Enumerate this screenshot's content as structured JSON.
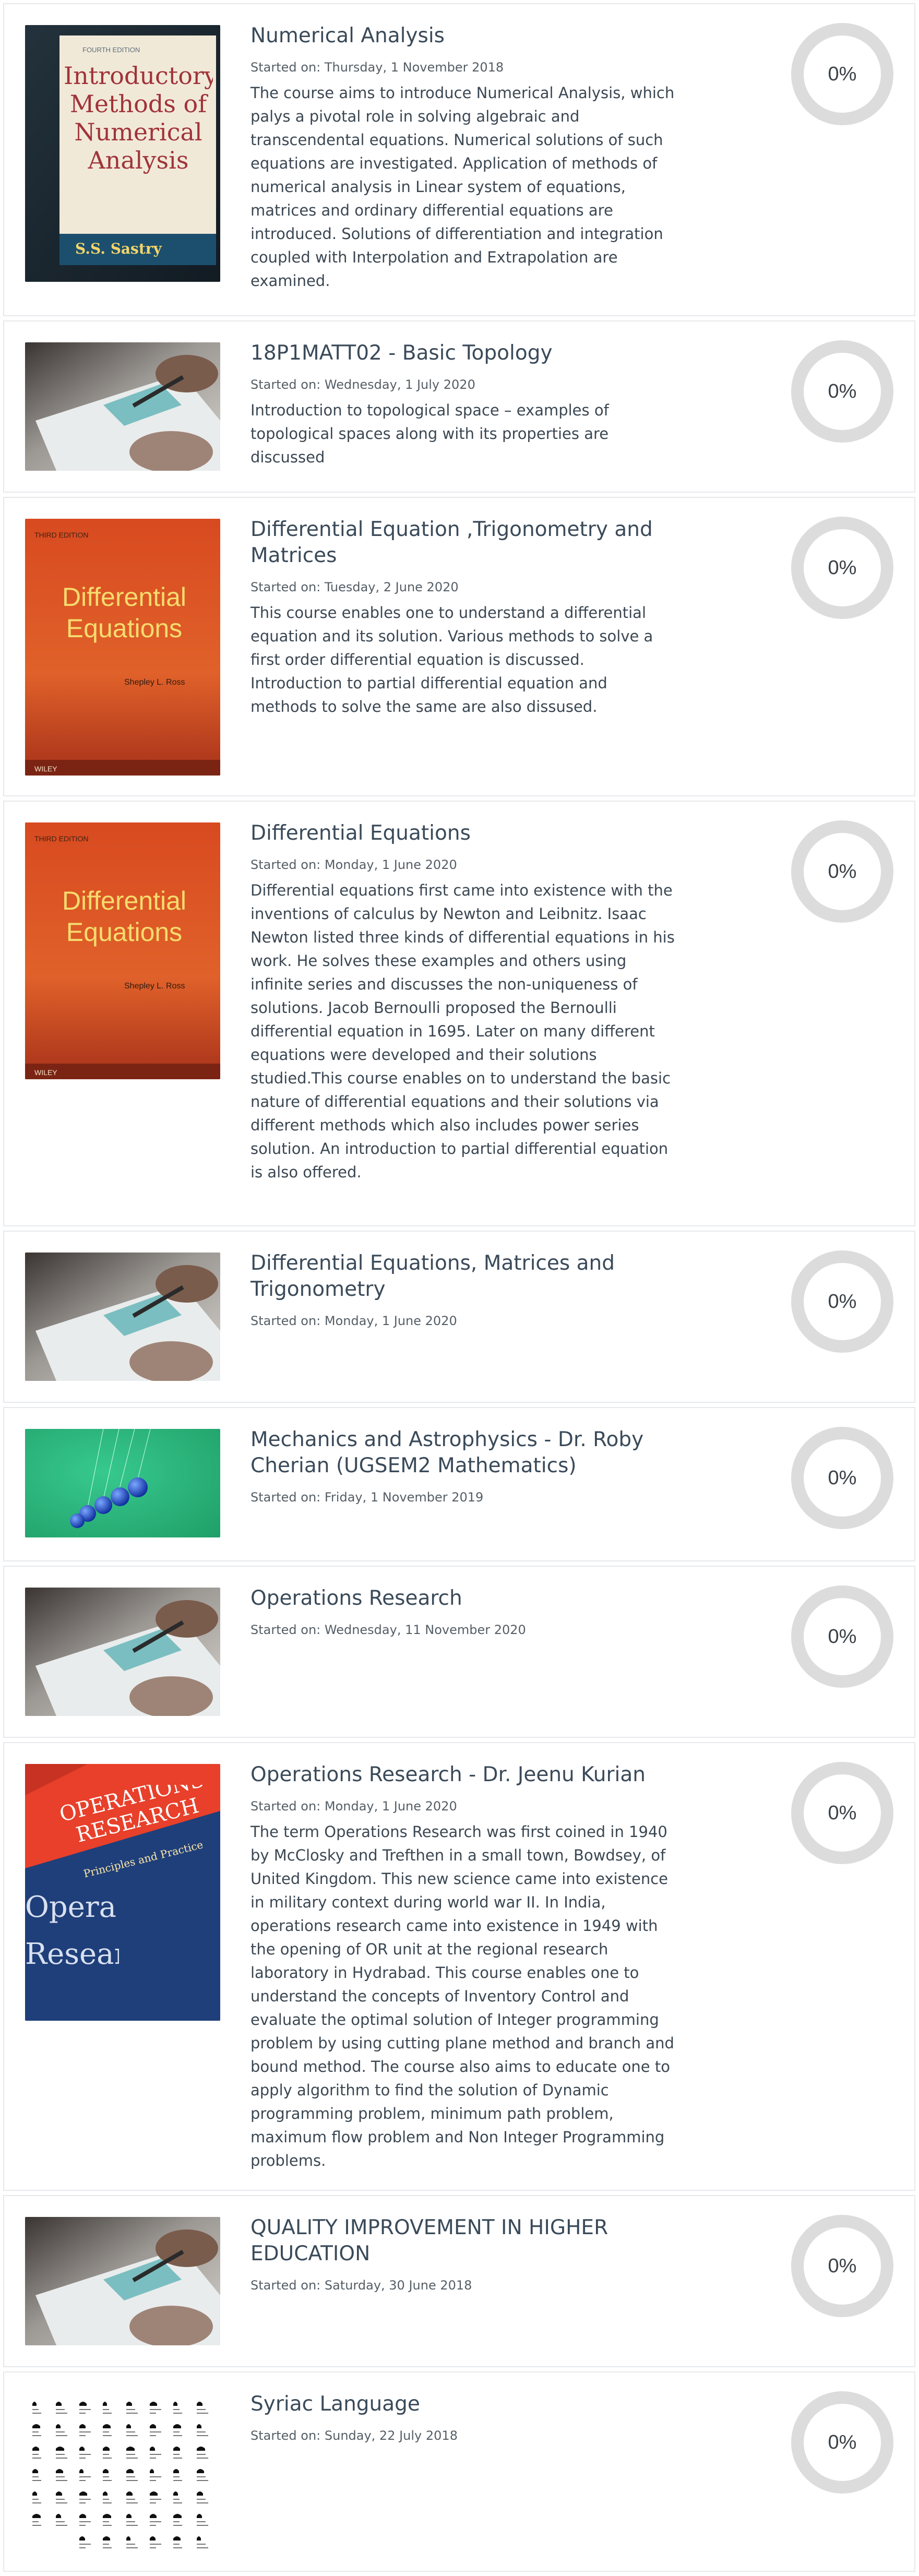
{
  "courses": [
    {
      "title": "Numerical Analysis",
      "started": "Started on: Thursday, 1 November 2018",
      "description": "The course aims to introduce Numerical Analysis, which palys a pivotal role in solving algebraic and transcendental equations. Numerical solutions of such equations are investigated. Application of methods of numerical analysis in Linear system of equations, matrices and ordinary differential equations are introduced. Solutions of differentiation and integration coupled with Interpolation and Extrapolation are examined.",
      "progress": "0%",
      "thumbnail": "book-cover-introductory-numerical-analysis",
      "cover": {
        "edition": "FOURTH EDITION",
        "title": "Introductory Methods of Numerical Analysis",
        "author": "S.S. Sastry"
      }
    },
    {
      "title": "18P1MATT02 - Basic Topology",
      "started": "Started on: Wednesday, 1 July 2020",
      "description": "Introduction to topological space – examples of topological spaces along with its properties are discussed",
      "progress": "0%",
      "thumbnail": "hand-writing-photo"
    },
    {
      "title": "Differential Equation ,Trigonometry and Matrices",
      "started": "Started on: Tuesday, 2 June 2020",
      "description": "This course enables one to understand a differential equation and its solution. Various methods to solve a first order differential equation is discussed. Introduction to partial differential equation and methods to solve the same are also dissused.",
      "progress": "0%",
      "thumbnail": "book-cover-differential-equations",
      "cover": {
        "edition": "THIRD EDITION",
        "title": "Differential Equations",
        "author": "Shepley L. Ross",
        "publisher": "WILEY"
      }
    },
    {
      "title": "Differential Equations",
      "started": "Started on: Monday, 1 June 2020",
      "description": "Differential equations first came into existence with the inventions of calculus by Newton and Leibnitz. Isaac Newton listed three kinds of differential equations in his work. He solves these examples and others using infinite series and discusses the non-uniqueness of solutions. Jacob Bernoulli proposed the Bernoulli differential equation in 1695. Later on many different equations were developed and their solutions studied.This course enables on to understand the basic nature of differential equations and their solutions via different methods which also includes power series solution. An introduction to partial differential equation is also offered.",
      "progress": "0%",
      "thumbnail": "book-cover-differential-equations",
      "cover": {
        "edition": "THIRD EDITION",
        "title": "Differential Equations",
        "author": "Shepley L. Ross",
        "publisher": "WILEY"
      }
    },
    {
      "title": "Differential Equations, Matrices and Trigonometry",
      "started": "Started on: Monday, 1 June 2020",
      "description": "",
      "progress": "0%",
      "thumbnail": "hand-writing-photo"
    },
    {
      "title": "Mechanics and Astrophysics - Dr. Roby Cherian (UGSEM2 Mathematics)",
      "started": "Started on: Friday, 1 November 2019",
      "description": "",
      "progress": "0%",
      "thumbnail": "newtons-cradle-photo"
    },
    {
      "title": "Operations Research",
      "started": "Started on: Wednesday, 11 November 2020",
      "description": "",
      "progress": "0%",
      "thumbnail": "hand-writing-photo"
    },
    {
      "title": "Operations Research - Dr. Jeenu Kurian",
      "started": "Started on: Monday, 1 June 2020",
      "description": "The term Operations Research was first coined in 1940 by McClosky and Trefthen in a small town, Bowdsey, of United Kingdom. This new science came into existence in military context during world war II. In India, operations research came into existence in 1949 with the opening of OR unit at the regional research laboratory in Hydrabad. This course enables one to understand the concepts of Inventory Control and evaluate the optimal solution of Integer programming problem by using cutting plane method and branch and bound method. The course also aims to educate one to apply algorithm to find the solution of Dynamic  programming problem, minimum path problem, maximum flow problem and Non Integer Programming problems.",
      "progress": "0%",
      "thumbnail": "book-cover-operations-research",
      "cover": {
        "title": "OPERATIONS RESEARCH",
        "subtitle": "Principles and Practice",
        "spine": "Opera Resear"
      }
    },
    {
      "title": "QUALITY IMPROVEMENT IN HIGHER EDUCATION",
      "started": "Started on: Saturday, 30 June 2018",
      "description": "",
      "progress": "0%",
      "thumbnail": "hand-writing-photo"
    },
    {
      "title": "Syriac Language",
      "started": "Started on: Sunday, 22 July 2018",
      "description": "",
      "progress": "0%",
      "thumbnail": "syriac-alphabet-chart"
    }
  ]
}
